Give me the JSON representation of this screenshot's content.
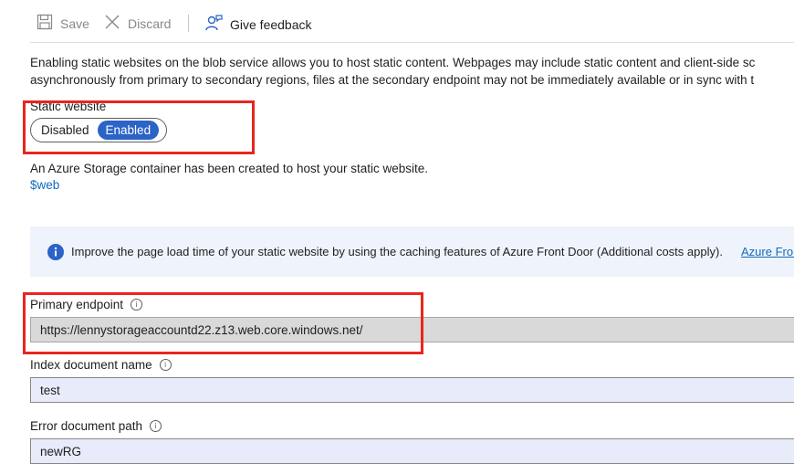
{
  "toolbar": {
    "save_label": "Save",
    "discard_label": "Discard",
    "feedback_label": "Give feedback"
  },
  "description": {
    "line1": "Enabling static websites on the blob service allows you to host static content. Webpages may include static content and client-side sc",
    "line2": "asynchronously from primary to secondary regions, files at the secondary endpoint may not be immediately available or in sync with t"
  },
  "static_website": {
    "label": "Static website",
    "options": [
      "Disabled",
      "Enabled"
    ],
    "selected": "Enabled"
  },
  "container_note": {
    "text": "An Azure Storage container has been created to host your static website.",
    "link": "$web"
  },
  "info_banner": {
    "text": "Improve the page load time of your static website by using the caching features of Azure Front Door (Additional costs apply).",
    "link": "Azure Fron"
  },
  "primary_endpoint": {
    "label": "Primary endpoint",
    "value": "https://lennystorageaccountd22.z13.web.core.windows.net/"
  },
  "index_document": {
    "label": "Index document name",
    "value": "test"
  },
  "error_document": {
    "label": "Error document path",
    "value": "newRG"
  },
  "colors": {
    "accent": "#2b63c6",
    "link": "#0f6cbd",
    "highlight_box": "#e8261e",
    "info_bg": "#eff3fc"
  }
}
